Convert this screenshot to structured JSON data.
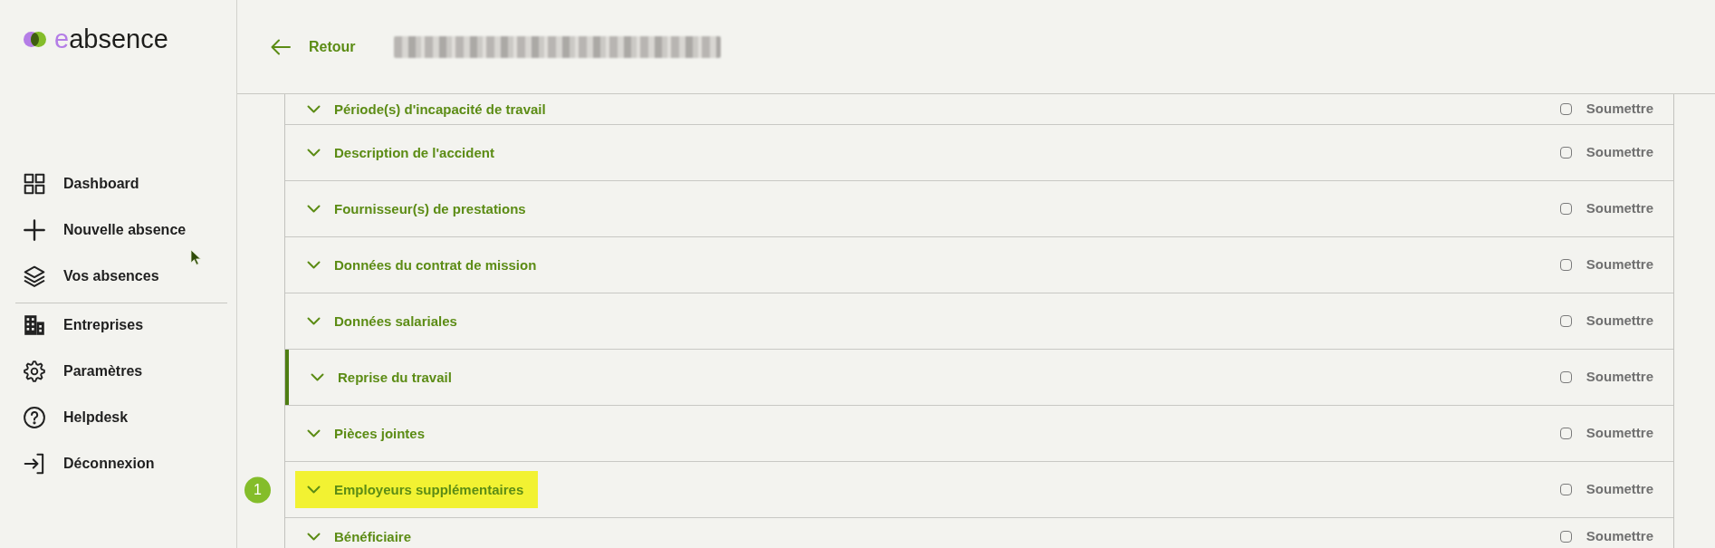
{
  "sidebar": {
    "logo": {
      "accent": "e",
      "text": "absence"
    },
    "nav_groups": [
      [
        {
          "label": "Dashboard",
          "selected": false
        },
        {
          "label": "Nouvelle absence",
          "selected": false
        },
        {
          "label": "Vos absences",
          "selected": false
        }
      ],
      [
        {
          "label": "Entreprises",
          "selected": false
        },
        {
          "label": "Paramètres",
          "selected": false
        },
        {
          "label": "Helpdesk",
          "selected": false
        },
        {
          "label": "Déconnexion",
          "selected": false
        }
      ]
    ]
  },
  "header": {
    "back_label": "Retour"
  },
  "sections": [
    {
      "title": "Période(s) d'incapacité de travail",
      "selected": false,
      "highlighted": false,
      "checked": false,
      "checkbox_label": "Soumettre"
    },
    {
      "title": "Description de l'accident",
      "selected": false,
      "highlighted": false,
      "checked": false,
      "checkbox_label": "Soumettre"
    },
    {
      "title": "Fournisseur(s) de prestations",
      "selected": false,
      "highlighted": false,
      "checked": false,
      "checkbox_label": "Soumettre"
    },
    {
      "title": "Données du contrat de mission",
      "selected": false,
      "highlighted": false,
      "checked": false,
      "checkbox_label": "Soumettre"
    },
    {
      "title": "Données salariales",
      "selected": false,
      "highlighted": false,
      "checked": false,
      "checkbox_label": "Soumettre"
    },
    {
      "title": "Reprise du travail",
      "selected": true,
      "highlighted": false,
      "checked": false,
      "checkbox_label": "Soumettre"
    },
    {
      "title": "Pièces jointes",
      "selected": false,
      "highlighted": false,
      "checked": false,
      "checkbox_label": "Soumettre"
    },
    {
      "title": "Employeurs supplémentaires",
      "selected": false,
      "highlighted": true,
      "step_badge": "1",
      "checked": false,
      "checkbox_label": "Soumettre"
    },
    {
      "title": "Bénéficiaire",
      "selected": false,
      "highlighted": false,
      "checked": false,
      "checkbox_label": "Soumettre"
    }
  ]
}
